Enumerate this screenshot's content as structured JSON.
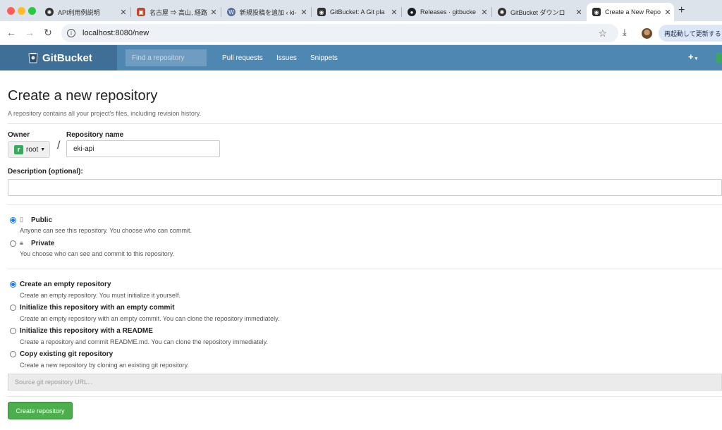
{
  "browser": {
    "tabs": [
      {
        "title": "API利用例説明",
        "favicon": "openai-icon"
      },
      {
        "title": "名古屋 ⇒ 高山, 経路情",
        "favicon": "train-icon"
      },
      {
        "title": "新規投稿を追加 ‹ ki-",
        "favicon": "wordpress-icon"
      },
      {
        "title": "GitBucket: A Git pla",
        "favicon": "gitbucket-icon"
      },
      {
        "title": "Releases · gitbucke",
        "favicon": "github-icon"
      },
      {
        "title": "GitBucket ダウンロ",
        "favicon": "openai-icon"
      },
      {
        "title": "Create a New Repo",
        "favicon": "gitbucket-icon",
        "active": true
      }
    ],
    "url": "localhost:8080/new",
    "relaunch_label": "再起動して更新する",
    "colors": {
      "close": "#ff5f57",
      "minimize": "#febc2e",
      "maximize": "#28c840"
    }
  },
  "app": {
    "brand": "GitBucket",
    "search_placeholder": "Find a repository",
    "nav": [
      "Pull requests",
      "Issues",
      "Snippets"
    ],
    "plus_label": "+",
    "header_color": "#4f87b3"
  },
  "form": {
    "title": "Create a new repository",
    "subtitle": "A repository contains all your project's files, including revision history.",
    "owner_label": "Owner",
    "owner_value": "root",
    "owner_avatar": "r",
    "separator": "/",
    "repo_name_label": "Repository name",
    "repo_name_value": "eki-api",
    "description_label": "Description (optional):",
    "description_value": "",
    "visibility": [
      {
        "title": "Public",
        "desc": "Anyone can see this repository. You choose who can commit.",
        "checked": true,
        "icon": "repo-icon"
      },
      {
        "title": "Private",
        "desc": "You choose who can see and commit to this repository.",
        "checked": false,
        "icon": "lock-icon"
      }
    ],
    "init_options": [
      {
        "title": "Create an empty repository",
        "desc": "Create an empty repository. You must initialize it yourself.",
        "checked": true
      },
      {
        "title": "Initialize this repository with an empty commit",
        "desc": "Create an empty repository with an empty commit. You can clone the repository immediately.",
        "checked": false
      },
      {
        "title": "Initialize this repository with a README",
        "desc": "Create a repository and commit README.md. You can clone the repository immediately.",
        "checked": false
      },
      {
        "title": "Copy existing git repository",
        "desc": "Create a new repository by cloning an existing git repository.",
        "checked": false
      }
    ],
    "source_url_placeholder": "Source git repository URL...",
    "submit_label": "Create repository",
    "submit_color": "#4cae4c"
  }
}
